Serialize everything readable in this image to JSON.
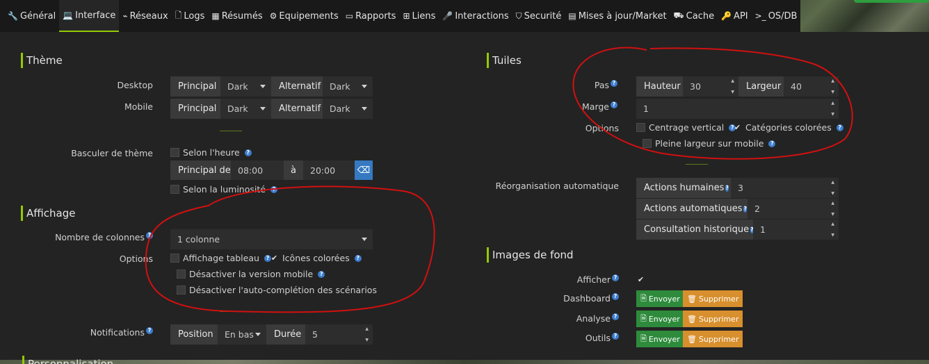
{
  "tabs": [
    {
      "label": "Général",
      "icon": "wrench-icon",
      "glyph": "🔧"
    },
    {
      "label": "Interface",
      "icon": "laptop-icon",
      "glyph": "💻"
    },
    {
      "label": "Réseaux",
      "icon": "rss-icon",
      "glyph": "⌁"
    },
    {
      "label": "Logs",
      "icon": "file-icon",
      "glyph": "🗋"
    },
    {
      "label": "Résumés",
      "icon": "table-icon",
      "glyph": "▦"
    },
    {
      "label": "Equipements",
      "icon": "gears-icon",
      "glyph": "⚙"
    },
    {
      "label": "Rapports",
      "icon": "card-icon",
      "glyph": "▭"
    },
    {
      "label": "Liens",
      "icon": "sitemap-icon",
      "glyph": "⊞"
    },
    {
      "label": "Interactions",
      "icon": "microphone-icon",
      "glyph": "🎤"
    },
    {
      "label": "Securité",
      "icon": "shield-icon",
      "glyph": "⛉"
    },
    {
      "label": "Mises à jour/Market",
      "icon": "hdd-icon",
      "glyph": "▤"
    },
    {
      "label": "Cache",
      "icon": "car-icon",
      "glyph": "⛟"
    },
    {
      "label": "API",
      "icon": "key-icon",
      "glyph": "🔑"
    },
    {
      "label": "OS/DB",
      "icon": "terminal-icon",
      "glyph": ">_"
    }
  ],
  "theme": {
    "title": "Thème",
    "desktop": {
      "label": "Desktop",
      "main": "Principal",
      "main_value": "Dark",
      "alt": "Alternatif",
      "alt_value": "Dark"
    },
    "mobile": {
      "label": "Mobile",
      "main": "Principal",
      "main_value": "Dark",
      "alt": "Alternatif",
      "alt_value": "Dark"
    },
    "switch_label": "Basculer de thème",
    "by_time": "Selon l'heure",
    "principal_de": "Principal de",
    "from": "08:00",
    "a": "à",
    "to": "20:00",
    "by_brightness": "Selon la luminosité"
  },
  "display": {
    "title": "Affichage",
    "columns_label": "Nombre de colonnes",
    "columns_value": "1 colonne",
    "options_label": "Options",
    "table_display": "Affichage tableau",
    "colored_icons": "Icônes colorées",
    "disable_mobile": "Désactiver la version mobile",
    "disable_autocomplete": "Désactiver l'auto-complétion des scénarios",
    "notifications_label": "Notifications",
    "position": "Position",
    "position_value": "En bas",
    "duration": "Durée",
    "duration_value": "5"
  },
  "tiles": {
    "title": "Tuiles",
    "step_label": "Pas",
    "height": "Hauteur",
    "height_value": "30",
    "width": "Largeur",
    "width_value": "40",
    "margin_label": "Marge",
    "margin_value": "1",
    "options_label": "Options",
    "vertical_center": "Centrage vertical",
    "colored_categories": "Catégories colorées",
    "full_width_mobile": "Pleine largeur sur mobile",
    "reorg_label": "Réorganisation automatique",
    "human_actions": "Actions humaines",
    "human_value": "3",
    "auto_actions": "Actions automatiques",
    "auto_value": "2",
    "history": "Consultation historique",
    "history_value": "1"
  },
  "backgrounds": {
    "title": "Images de fond",
    "show_label": "Afficher",
    "dashboard_label": "Dashboard",
    "analysis_label": "Analyse",
    "tools_label": "Outils",
    "send": "Envoyer",
    "delete": "Supprimer"
  },
  "personalisation_title": "Personnalisation",
  "colors": {
    "accent": "#94ca02",
    "annotation": "#d21010",
    "send": "#2e8b3c",
    "delete": "#d88f2d",
    "info": "#3d7ed0"
  }
}
